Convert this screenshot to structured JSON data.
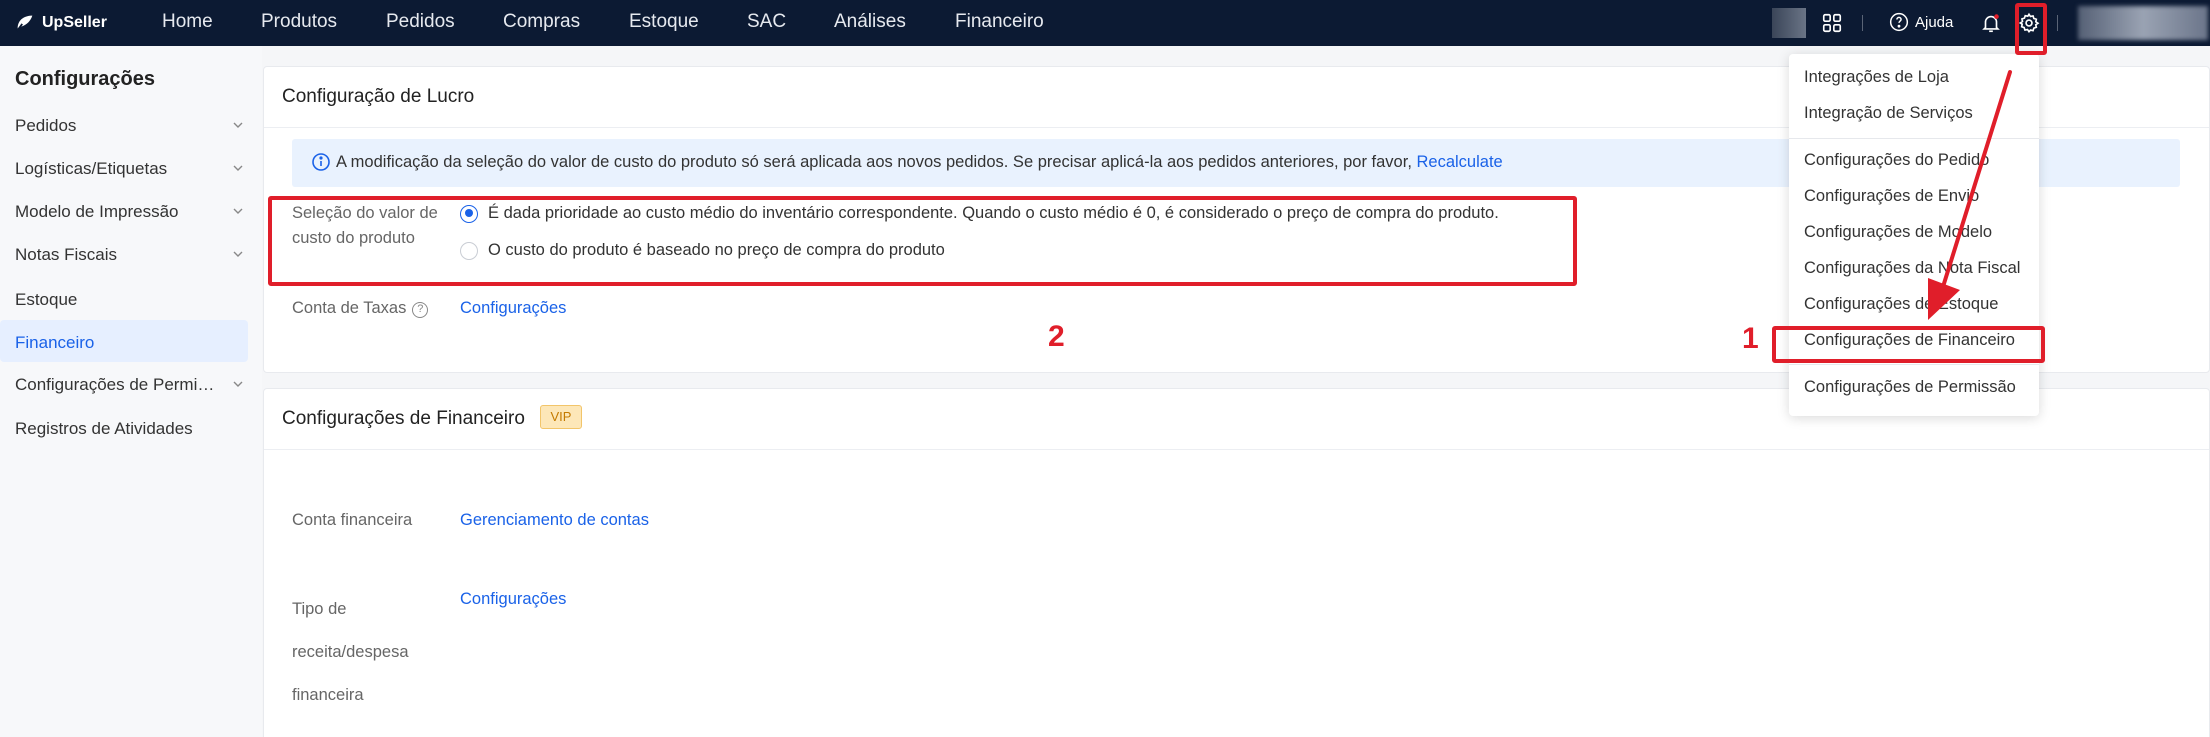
{
  "app": {
    "logo_text": "UpSeller"
  },
  "nav": {
    "items": [
      "Home",
      "Produtos",
      "Pedidos",
      "Compras",
      "Estoque",
      "SAC",
      "Análises",
      "Financeiro"
    ]
  },
  "header_right": {
    "help_label": "Ajuda"
  },
  "sidebar": {
    "title": "Configurações",
    "items": [
      {
        "label": "Pedidos",
        "expandable": true
      },
      {
        "label": "Logísticas/Etiquetas",
        "expandable": true
      },
      {
        "label": "Modelo de Impressão",
        "expandable": true
      },
      {
        "label": "Notas Fiscais",
        "expandable": true
      },
      {
        "label": "Estoque",
        "expandable": false
      },
      {
        "label": "Financeiro",
        "expandable": false,
        "active": true
      },
      {
        "label": "Configurações de Permi…",
        "expandable": true
      },
      {
        "label": "Registros de Atividades",
        "expandable": false
      }
    ]
  },
  "profit_card": {
    "title": "Configuração de Lucro",
    "info_text": "A modificação da seleção do valor de custo do produto só será aplicada aos novos pedidos. Se precisar aplicá-la aos pedidos anteriores, por favor,",
    "info_link": "Recalculate",
    "cost_label_line1": "Seleção do valor de",
    "cost_label_line2": "custo do produto",
    "option1": "É dada prioridade ao custo médio do inventário correspondente. Quando o custo médio é 0, é considerado o preço de compra do produto.",
    "option2": "O custo do produto é baseado no preço de compra do produto",
    "selected_option": 1,
    "tax_label": "Conta de Taxas",
    "tax_link": "Configurações"
  },
  "finance_card": {
    "title": "Configurações de Financeiro",
    "vip_badge": "VIP",
    "account_label": "Conta financeira",
    "account_link": "Gerenciamento de contas",
    "type_label_line1": "Tipo de",
    "type_label_line2": "receita/despesa",
    "type_label_line3": "financeira",
    "type_link": "Configurações"
  },
  "settings_dropdown": {
    "group1": [
      "Integrações de Loja",
      "Integração de Serviços"
    ],
    "group2": [
      "Configurações do Pedido",
      "Configurações de Envio",
      "Configurações de Modelo",
      "Configurações da Nota Fiscal",
      "Configurações de Estoque",
      "Configurações de Financeiro"
    ],
    "group3": [
      "Configurações de Permissão"
    ]
  },
  "annotations": {
    "step1": "1",
    "step2": "2",
    "color": "#e01e2a"
  },
  "colors": {
    "nav_bg": "#0c1a33",
    "accent": "#1a62e8",
    "active_bg": "#e6efff",
    "info_bg": "#e9f2fe"
  }
}
